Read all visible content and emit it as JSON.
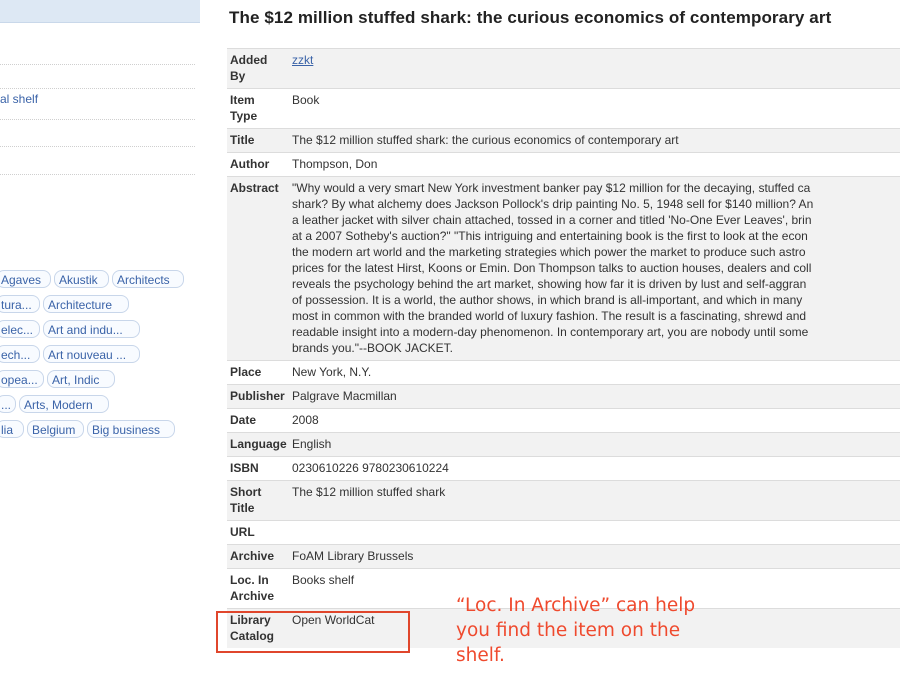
{
  "sidebar": {
    "items": [
      {
        "label": ""
      },
      {
        "label": ""
      },
      {
        "label": "al shelf"
      },
      {
        "label": ""
      },
      {
        "label": ""
      }
    ],
    "tags": [
      [
        "Agaves",
        "Akustik",
        "Architects"
      ],
      [
        "tura...",
        "Architecture"
      ],
      [
        "elec...",
        "Art and indu..."
      ],
      [
        "ech...",
        "Art nouveau ..."
      ],
      [
        "opea...",
        "Art, Indic"
      ],
      [
        "...",
        "Arts, Modern"
      ],
      [
        "lia",
        "Belgium",
        "Big business"
      ]
    ]
  },
  "item": {
    "title": "The $12 million stuffed shark: the curious economics of contemporary art",
    "fields": [
      {
        "label": "Added By",
        "value": "zzkt",
        "link": true
      },
      {
        "label": "Item Type",
        "value": "Book"
      },
      {
        "label": "Title",
        "value": "The $12 million stuffed shark: the curious economics of contemporary art"
      },
      {
        "label": "Author",
        "value": "Thompson, Don"
      },
      {
        "label": "Abstract",
        "lines": [
          "\"Why would a very smart New York investment banker pay $12 million for the decaying, stuffed ca",
          "shark? By what alchemy does Jackson Pollock's drip painting No. 5, 1948 sell for $140 million? An",
          "a leather jacket with silver chain attached, tossed in a corner and titled 'No-One Ever Leaves', brin",
          "at a 2007 Sotheby's auction?\" \"This intriguing and entertaining book is the first to look at the econ",
          "the modern art world and the marketing strategies which power the market to produce such astro",
          "prices for the latest Hirst, Koons or Emin. Don Thompson talks to auction houses, dealers and coll",
          "reveals the psychology behind the art market, showing how far it is driven by lust and self-aggran",
          "of possession. It is a world, the author shows, in which brand is all-important, and which in many",
          "most in common with the branded world of luxury fashion. The result is a fascinating, shrewd and",
          "readable insight into a modern-day phenomenon. In contemporary art, you are nobody until some",
          "brands you.\"--BOOK JACKET."
        ]
      },
      {
        "label": "Place",
        "value": "New York, N.Y."
      },
      {
        "label": "Publisher",
        "value": "Palgrave Macmillan"
      },
      {
        "label": "Date",
        "value": "2008"
      },
      {
        "label": "Language",
        "value": "English"
      },
      {
        "label": "ISBN",
        "value": "0230610226 9780230610224"
      },
      {
        "label": "Short Title",
        "value": "The $12 million stuffed shark"
      },
      {
        "label": "URL",
        "value": ""
      },
      {
        "label": "Archive",
        "value": "FoAM Library Brussels"
      },
      {
        "label": "Loc. In Archive",
        "value": "Books shelf"
      },
      {
        "label": "Library Catalog",
        "value": "Open WorldCat"
      }
    ]
  },
  "callout": {
    "lines": [
      "“Loc. In Archive” can help",
      "you find the item on the",
      "shelf."
    ],
    "color": "#ef4a2e"
  }
}
